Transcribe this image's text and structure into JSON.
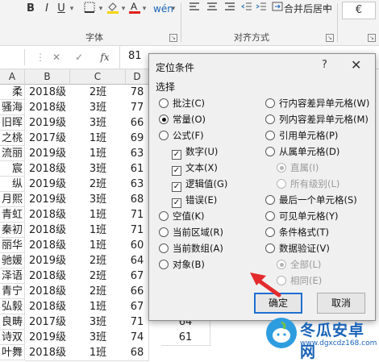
{
  "ribbon": {
    "font_buttons": [
      "B",
      "I",
      "U"
    ],
    "dropdown_glyph": "▾",
    "fill_color": "#f5d50a",
    "font_color_red": "#e0221b",
    "font_group_label": "字体",
    "align_group_label": "对齐方式",
    "merge_label": "合并后居中",
    "last_label": "€"
  },
  "formula_bar": {
    "cancel": "✕",
    "confirm": "✓",
    "fx": "fx",
    "value": "81"
  },
  "sheet": {
    "columns": [
      "A",
      "B",
      "C",
      "D"
    ],
    "rows": [
      {
        "a": "柔",
        "b": "2018级",
        "c": "2班",
        "d": "78"
      },
      {
        "a": "骚海",
        "b": "2018级",
        "c": "3班",
        "d": "77"
      },
      {
        "a": "旧晖",
        "b": "2019级",
        "c": "3班",
        "d": "66"
      },
      {
        "a": "之桃",
        "b": "2017级",
        "c": "1班",
        "d": "69"
      },
      {
        "a": "流丽",
        "b": "2019级",
        "c": "1班",
        "d": "63"
      },
      {
        "a": "宸",
        "b": "2018级",
        "c": "3班",
        "d": "61"
      },
      {
        "a": "纵",
        "b": "2019级",
        "c": "2班",
        "d": "63"
      },
      {
        "a": "月熙",
        "b": "2019级",
        "c": "3班",
        "d": "68"
      },
      {
        "a": "青虹",
        "b": "2018级",
        "c": "1班",
        "d": "71"
      },
      {
        "a": "秦初",
        "b": "2018级",
        "c": "1班",
        "d": "71"
      },
      {
        "a": "丽华",
        "b": "2018级",
        "c": "1班",
        "d": "60"
      },
      {
        "a": "驰媛",
        "b": "2019级",
        "c": "2班",
        "d": "64"
      },
      {
        "a": "泽语",
        "b": "2018级",
        "c": "2班",
        "d": "67"
      },
      {
        "a": "青宁",
        "b": "2018级",
        "c": "2班",
        "d": "66"
      },
      {
        "a": "弘毅",
        "b": "2018级",
        "c": "1班",
        "d": "67"
      },
      {
        "a": "良畴",
        "b": "2017级",
        "c": "3班",
        "d": "71"
      },
      {
        "a": "诗双",
        "b": "2019级",
        "c": "3班",
        "d": "74"
      },
      {
        "a": "叶舞",
        "b": "2018级",
        "c": "1班",
        "d": "68"
      }
    ],
    "partial_e": [
      "64",
      "61"
    ]
  },
  "dialog": {
    "title": "定位条件",
    "help": "?",
    "close": "✕",
    "section": "选择",
    "left_options": [
      {
        "label": "批注(C)",
        "kind": "radio",
        "checked": false,
        "disabled": false
      },
      {
        "label": "常量(O)",
        "kind": "radio",
        "checked": true,
        "disabled": false
      },
      {
        "label": "公式(F)",
        "kind": "radio",
        "checked": false,
        "disabled": false
      },
      {
        "label": "数字(U)",
        "kind": "check",
        "checked": true,
        "disabled": false
      },
      {
        "label": "文本(X)",
        "kind": "check",
        "checked": true,
        "disabled": false
      },
      {
        "label": "逻辑值(G)",
        "kind": "check",
        "checked": true,
        "disabled": false
      },
      {
        "label": "错误(E)",
        "kind": "check",
        "checked": true,
        "disabled": false
      },
      {
        "label": "空值(K)",
        "kind": "radio",
        "checked": false,
        "disabled": false
      },
      {
        "label": "当前区域(R)",
        "kind": "radio",
        "checked": false,
        "disabled": false
      },
      {
        "label": "当前数组(A)",
        "kind": "radio",
        "checked": false,
        "disabled": false
      },
      {
        "label": "对象(B)",
        "kind": "radio",
        "checked": false,
        "disabled": false
      }
    ],
    "right_options": [
      {
        "label": "行内容差异单元格(W)",
        "kind": "radio",
        "checked": false,
        "disabled": false
      },
      {
        "label": "列内容差异单元格(M)",
        "kind": "radio",
        "checked": false,
        "disabled": false
      },
      {
        "label": "引用单元格(P)",
        "kind": "radio",
        "checked": false,
        "disabled": false
      },
      {
        "label": "从属单元格(D)",
        "kind": "radio",
        "checked": false,
        "disabled": false
      },
      {
        "label": "直属(I)",
        "kind": "radio",
        "checked": true,
        "disabled": true
      },
      {
        "label": "所有级别(L)",
        "kind": "radio",
        "checked": false,
        "disabled": true
      },
      {
        "label": "最后一个单元格(S)",
        "kind": "radio",
        "checked": false,
        "disabled": false
      },
      {
        "label": "可见单元格(Y)",
        "kind": "radio",
        "checked": false,
        "disabled": false
      },
      {
        "label": "条件格式(T)",
        "kind": "radio",
        "checked": false,
        "disabled": false
      },
      {
        "label": "数据验证(V)",
        "kind": "radio",
        "checked": false,
        "disabled": false
      },
      {
        "label": "全部(L)",
        "kind": "radio",
        "checked": true,
        "disabled": true
      },
      {
        "label": "相同(E)",
        "kind": "radio",
        "checked": false,
        "disabled": true
      }
    ],
    "ok_label": "确定",
    "cancel_label": "取消"
  },
  "watermark": {
    "title": "冬瓜安卓网",
    "url": "www.dgxcdz168.com",
    "color": "#1a63b8"
  }
}
